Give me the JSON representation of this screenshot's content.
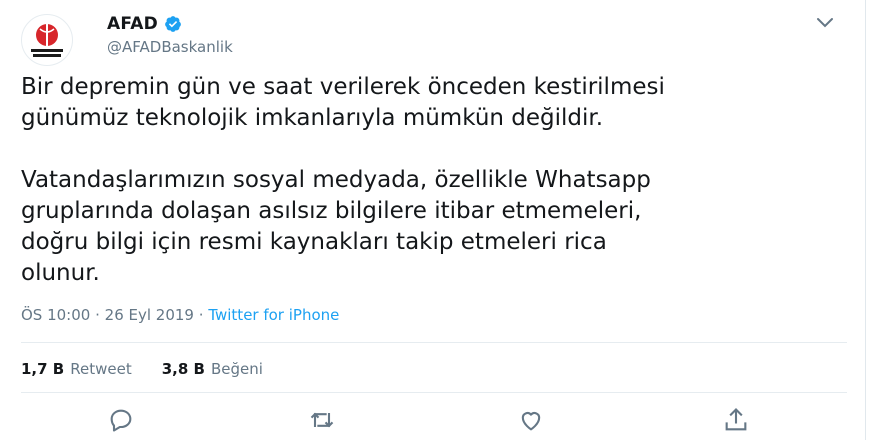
{
  "account": {
    "display_name": "AFAD",
    "handle": "@AFADBaskanlik",
    "avatar_text_line1": "AFETLERE",
    "avatar_text_line2": "HAZIRLIK YILI"
  },
  "tweet": {
    "lines_paragraph_1": [
      "Bir depremin gün ve saat verilerek önceden kestirilmesi",
      "günümüz teknolojik imkanlarıyla mümkün değildir."
    ],
    "lines_paragraph_2": [
      "Vatandaşlarımızın sosyal medyada, özellikle Whatsapp",
      "gruplarında dolaşan asılsız bilgilere itibar etmemeleri,",
      "doğru bilgi için resmi kaynakları takip etmeleri rica",
      "olunur."
    ]
  },
  "meta": {
    "time": "ÖS 10:00",
    "separator": "·",
    "date": "26 Eyl 2019",
    "source": "Twitter for iPhone"
  },
  "stats": {
    "retweets_count": "1,7 B",
    "retweets_label": "Retweet",
    "likes_count": "3,8 B",
    "likes_label": "Beğeni"
  },
  "icons": {
    "verified": "verified-badge-icon",
    "caret": "chevron-down-icon",
    "reply": "reply-icon",
    "retweet": "retweet-icon",
    "like": "heart-icon",
    "share": "share-icon"
  },
  "colors": {
    "twitter_blue": "#1da1f2",
    "secondary_text": "#657786",
    "primary_text": "#14171a",
    "avatar_red": "#d7262b"
  }
}
